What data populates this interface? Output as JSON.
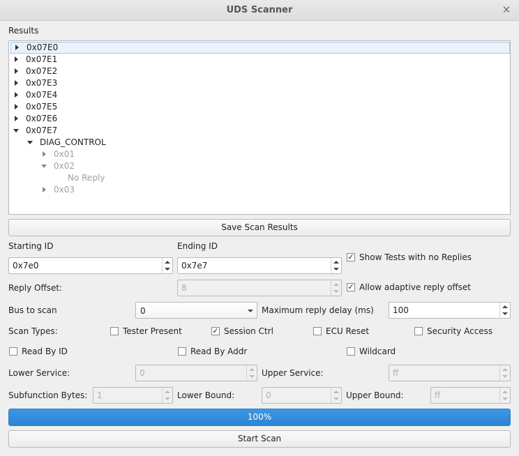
{
  "window": {
    "title": "UDS Scanner",
    "close_glyph": "✕"
  },
  "results": {
    "label": "Results",
    "tree": [
      {
        "text": "0x07E0",
        "level": 0,
        "arrow": "right",
        "selected": true,
        "gray": false
      },
      {
        "text": "0x07E1",
        "level": 0,
        "arrow": "right",
        "selected": false,
        "gray": false
      },
      {
        "text": "0x07E2",
        "level": 0,
        "arrow": "right",
        "selected": false,
        "gray": false
      },
      {
        "text": "0x07E3",
        "level": 0,
        "arrow": "right",
        "selected": false,
        "gray": false
      },
      {
        "text": "0x07E4",
        "level": 0,
        "arrow": "right",
        "selected": false,
        "gray": false
      },
      {
        "text": "0x07E5",
        "level": 0,
        "arrow": "right",
        "selected": false,
        "gray": false
      },
      {
        "text": "0x07E6",
        "level": 0,
        "arrow": "right",
        "selected": false,
        "gray": false
      },
      {
        "text": "0x07E7",
        "level": 0,
        "arrow": "down",
        "selected": false,
        "gray": false
      },
      {
        "text": "DIAG_CONTROL",
        "level": 1,
        "arrow": "down",
        "selected": false,
        "gray": false
      },
      {
        "text": "0x01",
        "level": 2,
        "arrow": "right",
        "selected": false,
        "gray": true
      },
      {
        "text": "0x02",
        "level": 2,
        "arrow": "down",
        "selected": false,
        "gray": true
      },
      {
        "text": "No Reply",
        "level": 3,
        "arrow": "none",
        "selected": false,
        "gray": true
      },
      {
        "text": "0x03",
        "level": 2,
        "arrow": "right",
        "selected": false,
        "gray": true
      }
    ]
  },
  "save_button": "Save Scan Results",
  "starting_id": {
    "label": "Starting ID",
    "value": "0x7e0"
  },
  "ending_id": {
    "label": "Ending ID",
    "value": "0x7e7"
  },
  "show_no_replies": {
    "label": "Show Tests with no Replies",
    "checked": true
  },
  "reply_offset": {
    "label": "Reply Offset:",
    "value": "8"
  },
  "adaptive_offset": {
    "label": "Allow adaptive reply offset",
    "checked": true
  },
  "bus": {
    "label": "Bus to scan",
    "value": "0"
  },
  "max_delay": {
    "label": "Maximum reply delay (ms)",
    "value": "100"
  },
  "scan_types": {
    "label": "Scan Types:",
    "tester_present": {
      "label": "Tester Present",
      "checked": false
    },
    "session_ctrl": {
      "label": "Session Ctrl",
      "checked": true
    },
    "ecu_reset": {
      "label": "ECU Reset",
      "checked": false
    },
    "security_access": {
      "label": "Security Access",
      "checked": false
    },
    "read_by_id": {
      "label": "Read By ID",
      "checked": false
    },
    "read_by_addr": {
      "label": "Read By Addr",
      "checked": false
    },
    "wildcard": {
      "label": "Wildcard",
      "checked": false
    }
  },
  "lower_service": {
    "label": "Lower Service:",
    "value": "0"
  },
  "upper_service": {
    "label": "Upper Service:",
    "value": "ff"
  },
  "subfunction_bytes": {
    "label": "Subfunction Bytes:",
    "value": "1"
  },
  "lower_bound": {
    "label": "Lower Bound:",
    "value": "0"
  },
  "upper_bound": {
    "label": "Upper Bound:",
    "value": "ff"
  },
  "progress": {
    "text": "100%",
    "fraction": 1.0
  },
  "start_button": "Start Scan",
  "check_glyph": "✓"
}
